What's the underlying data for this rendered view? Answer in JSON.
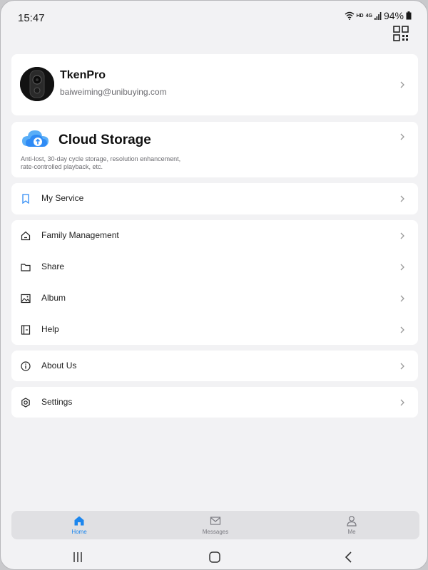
{
  "status_bar": {
    "time": "15:47",
    "network_badge": "HD",
    "network_type": "4G",
    "battery": "94%"
  },
  "header": {
    "qr_icon": "qr-code-icon"
  },
  "profile": {
    "name": "TkenPro",
    "email": "baiweiming@unibuying.com"
  },
  "cloud_storage": {
    "title": "Cloud Storage",
    "description": "Anti-lost, 30-day cycle storage, resolution enhancement, rate-controlled playback, etc.",
    "icon": "cloud-upload-icon",
    "icon_color": "#2f8bf5"
  },
  "menu": {
    "my_service": "My Service",
    "family_management": "Family Management",
    "share": "Share",
    "album": "Album",
    "help": "Help",
    "about_us": "About Us",
    "settings": "Settings"
  },
  "bottom_nav": {
    "home": "Home",
    "messages": "Messages",
    "me": "Me",
    "active": "home",
    "active_color": "#1c86ee"
  },
  "colors": {
    "background": "#f2f2f4",
    "card": "#ffffff",
    "accent": "#1c86ee"
  }
}
